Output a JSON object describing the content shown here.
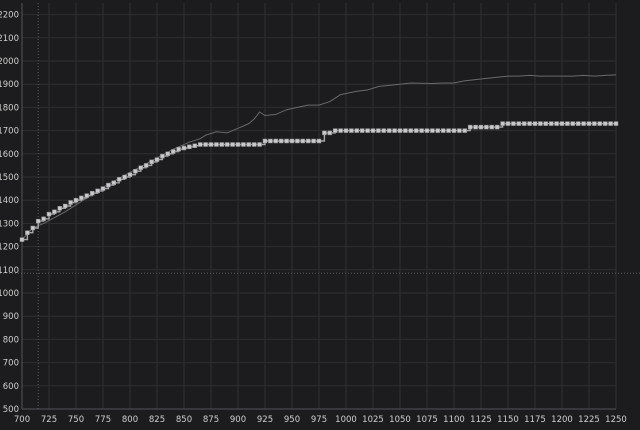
{
  "colors": {
    "background": "#1c1c1e",
    "grid": "#2f2f33",
    "axis": "#555559",
    "tick_text": "#cfcfcf",
    "upper_line": "#6a6a6e",
    "step_line": "#a8a8ac",
    "step_marker": "#c8c8cc",
    "divider": "#5a5a5e"
  },
  "chart_data": {
    "type": "line",
    "title": "",
    "xlabel": "",
    "ylabel": "",
    "xlim": [
      700,
      1250
    ],
    "ylim": [
      500,
      2250
    ],
    "x_ticks": [
      700,
      725,
      750,
      775,
      800,
      825,
      850,
      875,
      900,
      925,
      950,
      975,
      1000,
      1025,
      1050,
      1075,
      1100,
      1125,
      1150,
      1175,
      1200,
      1225,
      1250
    ],
    "y_ticks": [
      500,
      600,
      700,
      800,
      900,
      1000,
      1100,
      1200,
      1300,
      1400,
      1500,
      1600,
      1700,
      1800,
      1900,
      2000,
      2100,
      2200
    ],
    "grid": true,
    "horizontal_divider_y": 1085,
    "vertical_marker_x": 715,
    "series": [
      {
        "style": "thin-line",
        "x": [
          700,
          710,
          720,
          740,
          760,
          780,
          800,
          820,
          840,
          855,
          865,
          870,
          880,
          890,
          900,
          910,
          915,
          920,
          925,
          935,
          945,
          955,
          965,
          975,
          985,
          990,
          995,
          1000,
          1010,
          1020,
          1030,
          1040,
          1050,
          1060,
          1080,
          1090,
          1100,
          1110,
          1120,
          1130,
          1140,
          1150,
          1160,
          1170,
          1180,
          1190,
          1200,
          1210,
          1220,
          1230,
          1240,
          1250
        ],
        "y": [
          1230,
          1280,
          1300,
          1350,
          1410,
          1470,
          1520,
          1570,
          1620,
          1650,
          1665,
          1680,
          1695,
          1690,
          1710,
          1730,
          1750,
          1780,
          1765,
          1770,
          1790,
          1800,
          1810,
          1810,
          1825,
          1840,
          1855,
          1860,
          1870,
          1875,
          1890,
          1895,
          1900,
          1905,
          1903,
          1905,
          1905,
          1915,
          1920,
          1925,
          1930,
          1935,
          1935,
          1938,
          1935,
          1935,
          1935,
          1935,
          1938,
          1935,
          1938,
          1940
        ]
      },
      {
        "style": "step-markers",
        "x": [
          700,
          705,
          710,
          715,
          720,
          725,
          730,
          735,
          740,
          745,
          750,
          755,
          760,
          765,
          770,
          775,
          780,
          785,
          790,
          795,
          800,
          805,
          810,
          815,
          820,
          825,
          830,
          835,
          840,
          845,
          850,
          855,
          860,
          865,
          870,
          875,
          880,
          885,
          890,
          895,
          900,
          905,
          910,
          915,
          920,
          925,
          930,
          935,
          940,
          945,
          950,
          955,
          960,
          965,
          970,
          975,
          980,
          985,
          990,
          995,
          1000,
          1005,
          1010,
          1015,
          1020,
          1025,
          1030,
          1035,
          1040,
          1045,
          1050,
          1055,
          1060,
          1065,
          1070,
          1075,
          1080,
          1085,
          1090,
          1095,
          1100,
          1105,
          1110,
          1115,
          1120,
          1125,
          1130,
          1135,
          1140,
          1145,
          1150,
          1155,
          1160,
          1165,
          1170,
          1175,
          1180,
          1185,
          1190,
          1195,
          1200,
          1205,
          1210,
          1215,
          1220,
          1225,
          1230,
          1235,
          1240,
          1245,
          1250
        ],
        "y": [
          1230,
          1260,
          1280,
          1310,
          1320,
          1340,
          1350,
          1365,
          1375,
          1390,
          1400,
          1410,
          1420,
          1430,
          1440,
          1450,
          1465,
          1475,
          1490,
          1500,
          1510,
          1525,
          1540,
          1550,
          1565,
          1575,
          1590,
          1600,
          1610,
          1620,
          1625,
          1630,
          1635,
          1640,
          1640,
          1640,
          1640,
          1640,
          1640,
          1640,
          1640,
          1640,
          1640,
          1640,
          1640,
          1655,
          1655,
          1655,
          1655,
          1655,
          1655,
          1655,
          1655,
          1655,
          1655,
          1655,
          1690,
          1690,
          1700,
          1700,
          1700,
          1700,
          1700,
          1700,
          1700,
          1700,
          1700,
          1700,
          1700,
          1700,
          1700,
          1700,
          1700,
          1700,
          1700,
          1700,
          1700,
          1700,
          1700,
          1700,
          1700,
          1700,
          1700,
          1715,
          1715,
          1715,
          1715,
          1715,
          1715,
          1730,
          1730,
          1730,
          1730,
          1730,
          1730,
          1730,
          1730,
          1730,
          1730,
          1730,
          1730,
          1730,
          1730,
          1730,
          1730,
          1730,
          1730,
          1730,
          1730,
          1730,
          1730
        ]
      }
    ]
  }
}
